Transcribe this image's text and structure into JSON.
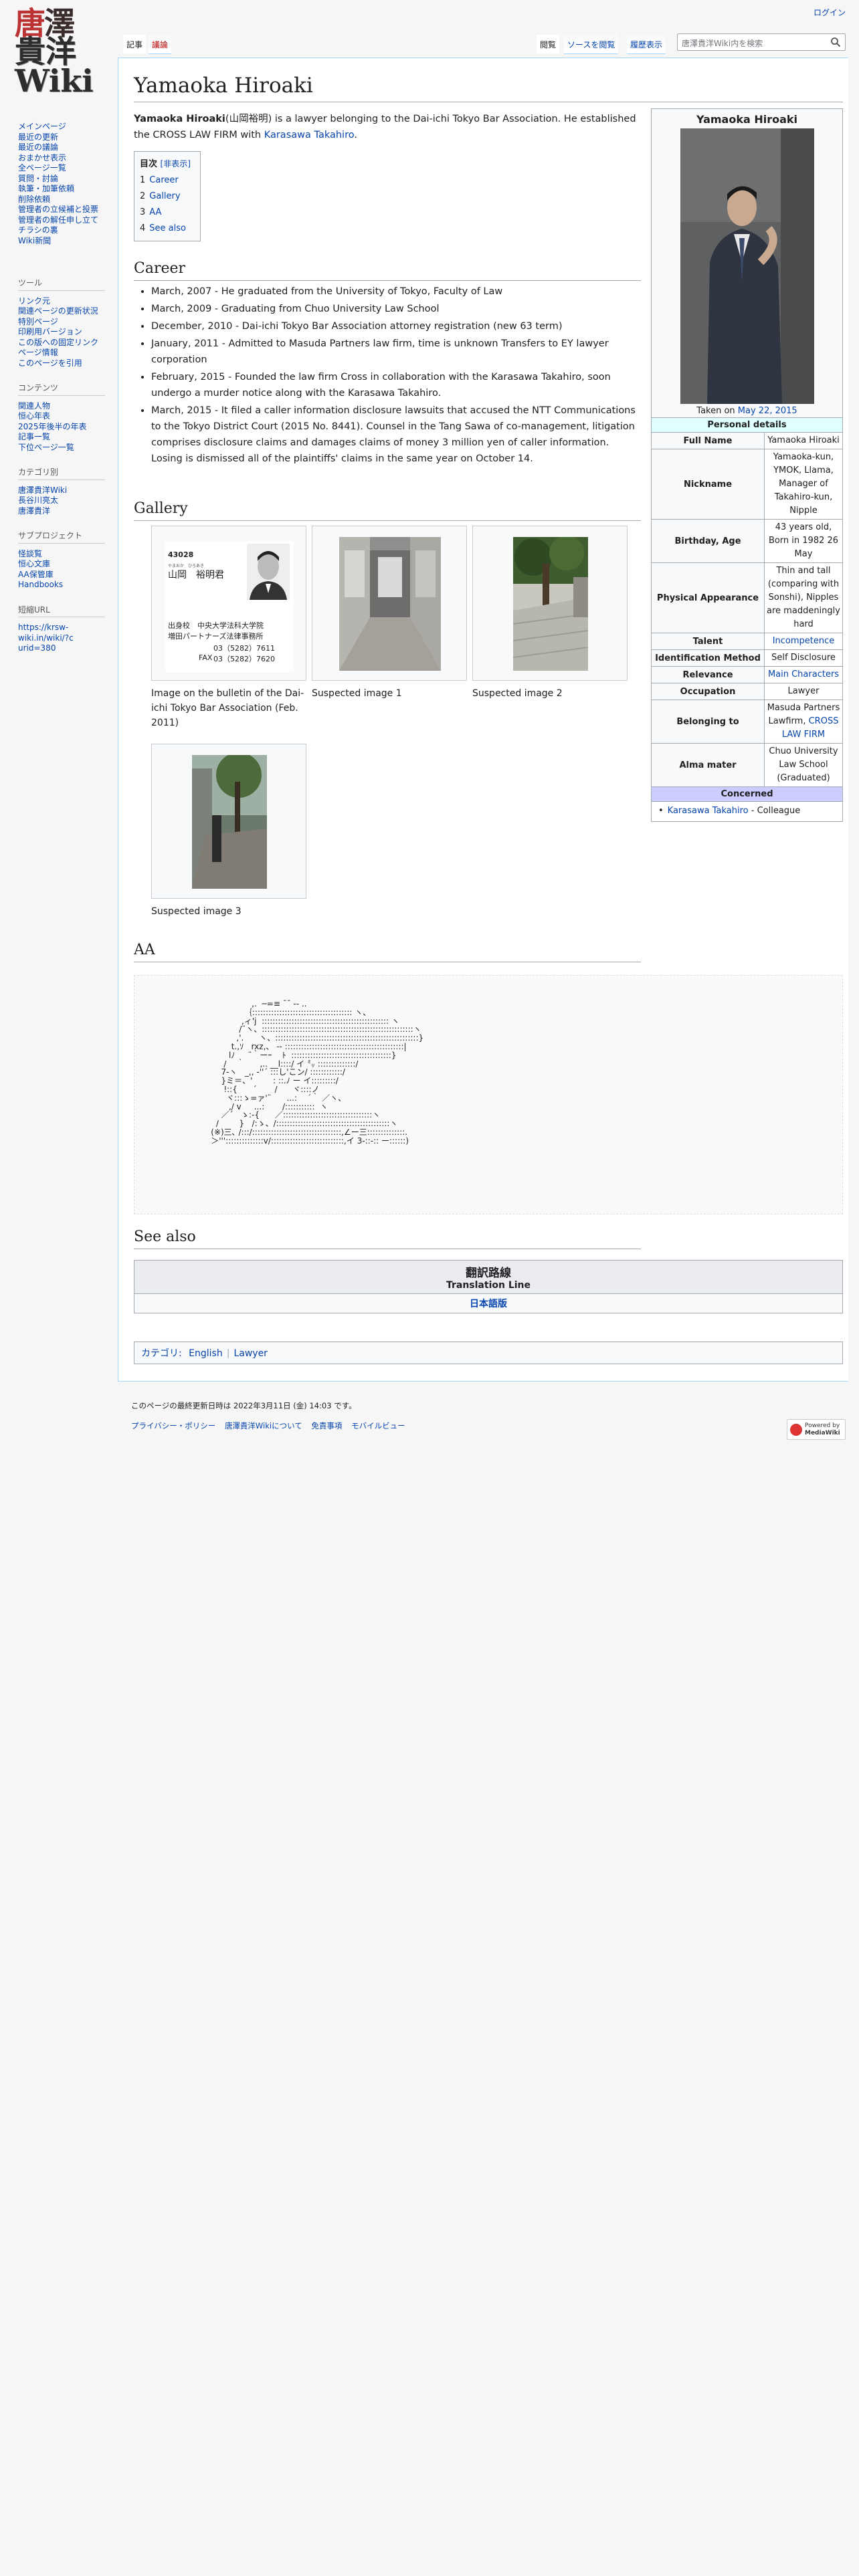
{
  "top": {
    "login": "ログイン"
  },
  "logo": {
    "line1": "唐澤",
    "line2": "貴洋",
    "line3": "Wiki"
  },
  "tabs": {
    "article": "記事",
    "talk": "議論",
    "read": "閲覧",
    "view_source": "ソースを閲覧",
    "history": "履歴表示"
  },
  "search": {
    "placeholder": "唐澤貴洋Wiki内を検索"
  },
  "sidebar": {
    "main": [
      "メインページ",
      "最近の更新",
      "最近の議論",
      "おまかせ表示",
      "全ページ一覧",
      "質問・討論",
      "執筆・加筆依頼",
      "削除依頼",
      "管理者の立候補と投票",
      "管理者の解任申し立て",
      "チラシの裏",
      "Wiki新聞"
    ],
    "tools_heading": "ツール",
    "tools": [
      "リンク元",
      "関連ページの更新状況",
      "特別ページ",
      "印刷用バージョン",
      "この版への固定リンク",
      "ページ情報",
      "このページを引用"
    ],
    "contents_heading": "コンテンツ",
    "contents": [
      "関連人物",
      "恒心年表",
      "2025年後半の年表",
      "記事一覧",
      "下位ページ一覧"
    ],
    "category_heading": "カテゴリ別",
    "category": [
      "唐澤貴洋Wiki",
      "長谷川亮太",
      "唐澤貴洋"
    ],
    "subproject_heading": "サブプロジェクト",
    "subproject": [
      "怪談覧",
      "恒心文庫",
      "AA保管庫",
      "Handbooks"
    ],
    "shorturl_heading": "短縮URL",
    "shorturl": "https://krsw-wiki.in/wiki/?curid=380"
  },
  "article": {
    "title": "Yamaoka Hiroaki",
    "intro_bold": "Yamaoka Hiroaki",
    "intro_kanji": "(山岡裕明)",
    "intro_text": " is a lawyer belonging to the Dai-ichi Tokyo Bar Association. He established the CROSS LAW FIRM with ",
    "intro_link": "Karasawa Takahiro",
    "intro_end": "."
  },
  "toc": {
    "title": "目次",
    "toggle": "[非表示]",
    "items": [
      {
        "num": "1",
        "label": "Career"
      },
      {
        "num": "2",
        "label": "Gallery"
      },
      {
        "num": "3",
        "label": "AA"
      },
      {
        "num": "4",
        "label": "See also"
      }
    ]
  },
  "sections": {
    "career": "Career",
    "gallery": "Gallery",
    "aa": "AA",
    "see_also": "See also"
  },
  "career": [
    "March, 2007 - He graduated from the University of Tokyo, Faculty of Law",
    "March, 2009 - Graduating from Chuo University Law School",
    "December, 2010 - Dai-ichi Tokyo Bar Association attorney registration (new 63 term)",
    "January, 2011 - Admitted to Masuda Partners law firm, time is unknown Transfers to EY lawyer corporation",
    "February, 2015 - Founded the law firm Cross in collaboration with the Karasawa Takahiro, soon undergo a murder notice along with the Karasawa Takahiro.",
    "March, 2015 - It filed a caller information disclosure lawsuits that accused the NTT Communications to the Tokyo District Court (2015 No. 8441). Counsel in the Tang Sawa of co-management, litigation comprises disclosure claims and damages claims of money 3 million yen of caller information. Losing is dismissed all of the plaintiffs' claims in the same year on October 14."
  ],
  "gallery": {
    "captions": [
      "Image on the bulletin of the Dai-ichi Tokyo Bar Association (Feb. 2011)",
      "Suspected image 1",
      "Suspected image 2",
      "Suspected image 3"
    ],
    "bulletin": {
      "number": "43028",
      "name": "山岡　裕明君",
      "ruby": "やまおか　ひろあき",
      "school": "出身校　中央大学法科大学院",
      "office": "増田パートナーズ法律事務所",
      "tel": "03（5282）7611",
      "fax_label": "FAX",
      "fax": "03（5282）7620"
    }
  },
  "infobox": {
    "title": "Yamaoka Hiroaki",
    "caption_prefix": "Taken on ",
    "caption_link": "May 22, 2015",
    "personal_heading": "Personal details",
    "rows": [
      {
        "label": "Full Name",
        "value": "Yamaoka Hiroaki"
      },
      {
        "label": "Nickname",
        "value": "Yamaoka-kun, YMOK, Llama, Manager of Takahiro-kun, Nipple"
      },
      {
        "label": "Birthday, Age",
        "value": "43 years old, Born in 1982 26 May"
      },
      {
        "label": "Physical Appearance",
        "value": "Thin and tall (comparing with Sonshi), Nipples are maddeningly hard"
      },
      {
        "label": "Talent",
        "value": "Incompetence"
      },
      {
        "label": "Identification Method",
        "value": "Self Disclosure"
      },
      {
        "label": "Relevance",
        "value": "Main Characters"
      },
      {
        "label": "Occupation",
        "value": "Lawyer"
      },
      {
        "label": "Belonging to",
        "value_text": "Masuda Partners Lawfirm, ",
        "value_link": "CROSS LAW FIRM"
      },
      {
        "label": "Alma mater",
        "value": "Chuo University Law School (Graduated)"
      }
    ],
    "concerned_heading": "Concerned",
    "concerned_link": "Karasawa Takahiro",
    "concerned_text": " - Colleague"
  },
  "aa_art": "                    ,.  ─=≡ ¯¯ ‐- ..\n                 ｛::::::::::::::::::::::::::::::::::::: ヽ、\n                ,ィ'j  ::::::::::::::::::::::::::::::::::::::::::::::: ヽ\n               /¨ヽ、::::::::::::::::::::::::::::::::::::::::::::::::::::::::ヽ\n              ,'.      ヽ、:::::::::::::::::::::::::::::::::::::::::::::::::::::}\n            t.,ｿ   rxz,、 ‐- ::::::::::::::::::::::::::::::::::::::::::::|\n           lﾉ     ¨｀ーｰ    ﾄ  :::::::::::::::::::::::::::::::::::::}\n         /    ｀      ,.. __l::::/ イ ㍉ ::::::::::::::/\n        7‐ヽ   _,, ‐''´ :::し'こン/ ::::::::::::/\n        }ミ＝、'        : ::.ﾉ ー イ:::::::::/\n         !::{      ´       /      ヾ::::ノ\n          ヾ:::ゝ=ァ'¨      ...:    ´｀ ／ヽ、\n           ,/ v     ...:       /:::::::::::  ヽ\n        ／´   ゝ:-{      ／:::::::::::::::::::::::::::::::::ヽ\n      /        }   /:ゝ、/::::::::::::::::::::::::::::::::::::::::::ヽ\n    (※)三､ /:::/:::::::::::::::::::::::::::::::::,∠ー三::::::::::::::.\n    ＞'''::::::::::::::v/:::::::::::::::::::::::::::,イ 3-::-:: ー::::::)",
  "see_also": {
    "title": "翻訳路線",
    "subtitle": "Translation Line",
    "link": "日本語版"
  },
  "categories": {
    "label": "カテゴリ:",
    "items": [
      "English",
      "Lawyer"
    ]
  },
  "footer": {
    "modified": "このページの最終更新日時は 2022年3月11日 (金) 14:03 です。",
    "links": [
      "プライバシー・ポリシー",
      "唐澤貴洋Wikiについて",
      "免責事項",
      "モバイルビュー"
    ],
    "powered_line1": "Powered by",
    "powered_line2": "MediaWiki"
  }
}
